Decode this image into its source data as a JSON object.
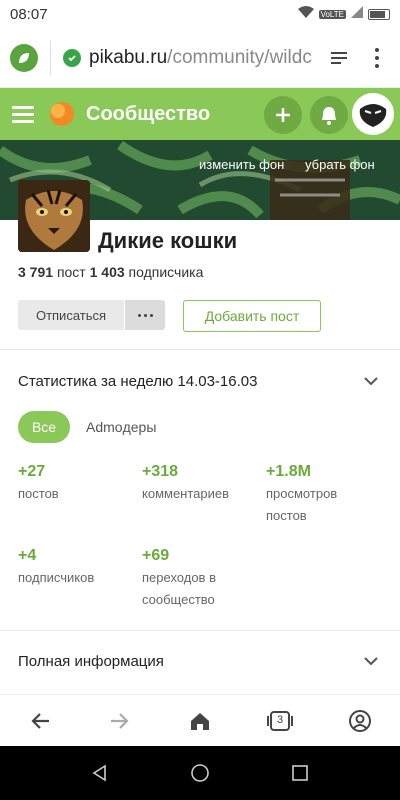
{
  "status_bar": {
    "time": "08:07",
    "network": "4G",
    "battery": "77"
  },
  "browser": {
    "url_host": "pikabu.ru",
    "url_path": "/community/wildc"
  },
  "site_header": {
    "title": "Сообщество"
  },
  "cover": {
    "change_bg": "изменить фон",
    "remove_bg": "убрать фон"
  },
  "community": {
    "name": "Дикие кошки",
    "posts_count": "3 791",
    "posts_label": "пост",
    "subscribers_count": "1 403",
    "subscribers_label": "подписчика",
    "unsubscribe_label": "Отписаться",
    "add_post_label": "Добавить пост"
  },
  "stats": {
    "title": "Статистика за неделю 14.03-16.03",
    "chips": [
      "Все",
      "Admoдеры"
    ],
    "items": [
      {
        "value": "+27",
        "label": "постов"
      },
      {
        "value": "+318",
        "label": "комментариев"
      },
      {
        "value": "+1.8M",
        "label": "просмотров постов"
      },
      {
        "value": "+4",
        "label": "подписчиков"
      },
      {
        "value": "+69",
        "label": "переходов в сообщество"
      }
    ]
  },
  "full_info": {
    "title": "Полная информация"
  },
  "bottom_nav": {
    "tabs_count": "3"
  },
  "colors": {
    "brand": "#8ac858",
    "accent_text": "#6aaa3a",
    "header_btn": "#6faa43"
  },
  "icons": [
    "browser-logo-icon",
    "lock-icon",
    "reader-mode-icon",
    "menu-icon",
    "plus-icon",
    "bell-icon",
    "chevron-down-icon",
    "back-icon",
    "forward-icon",
    "home-icon",
    "tabs-icon",
    "profile-icon"
  ]
}
